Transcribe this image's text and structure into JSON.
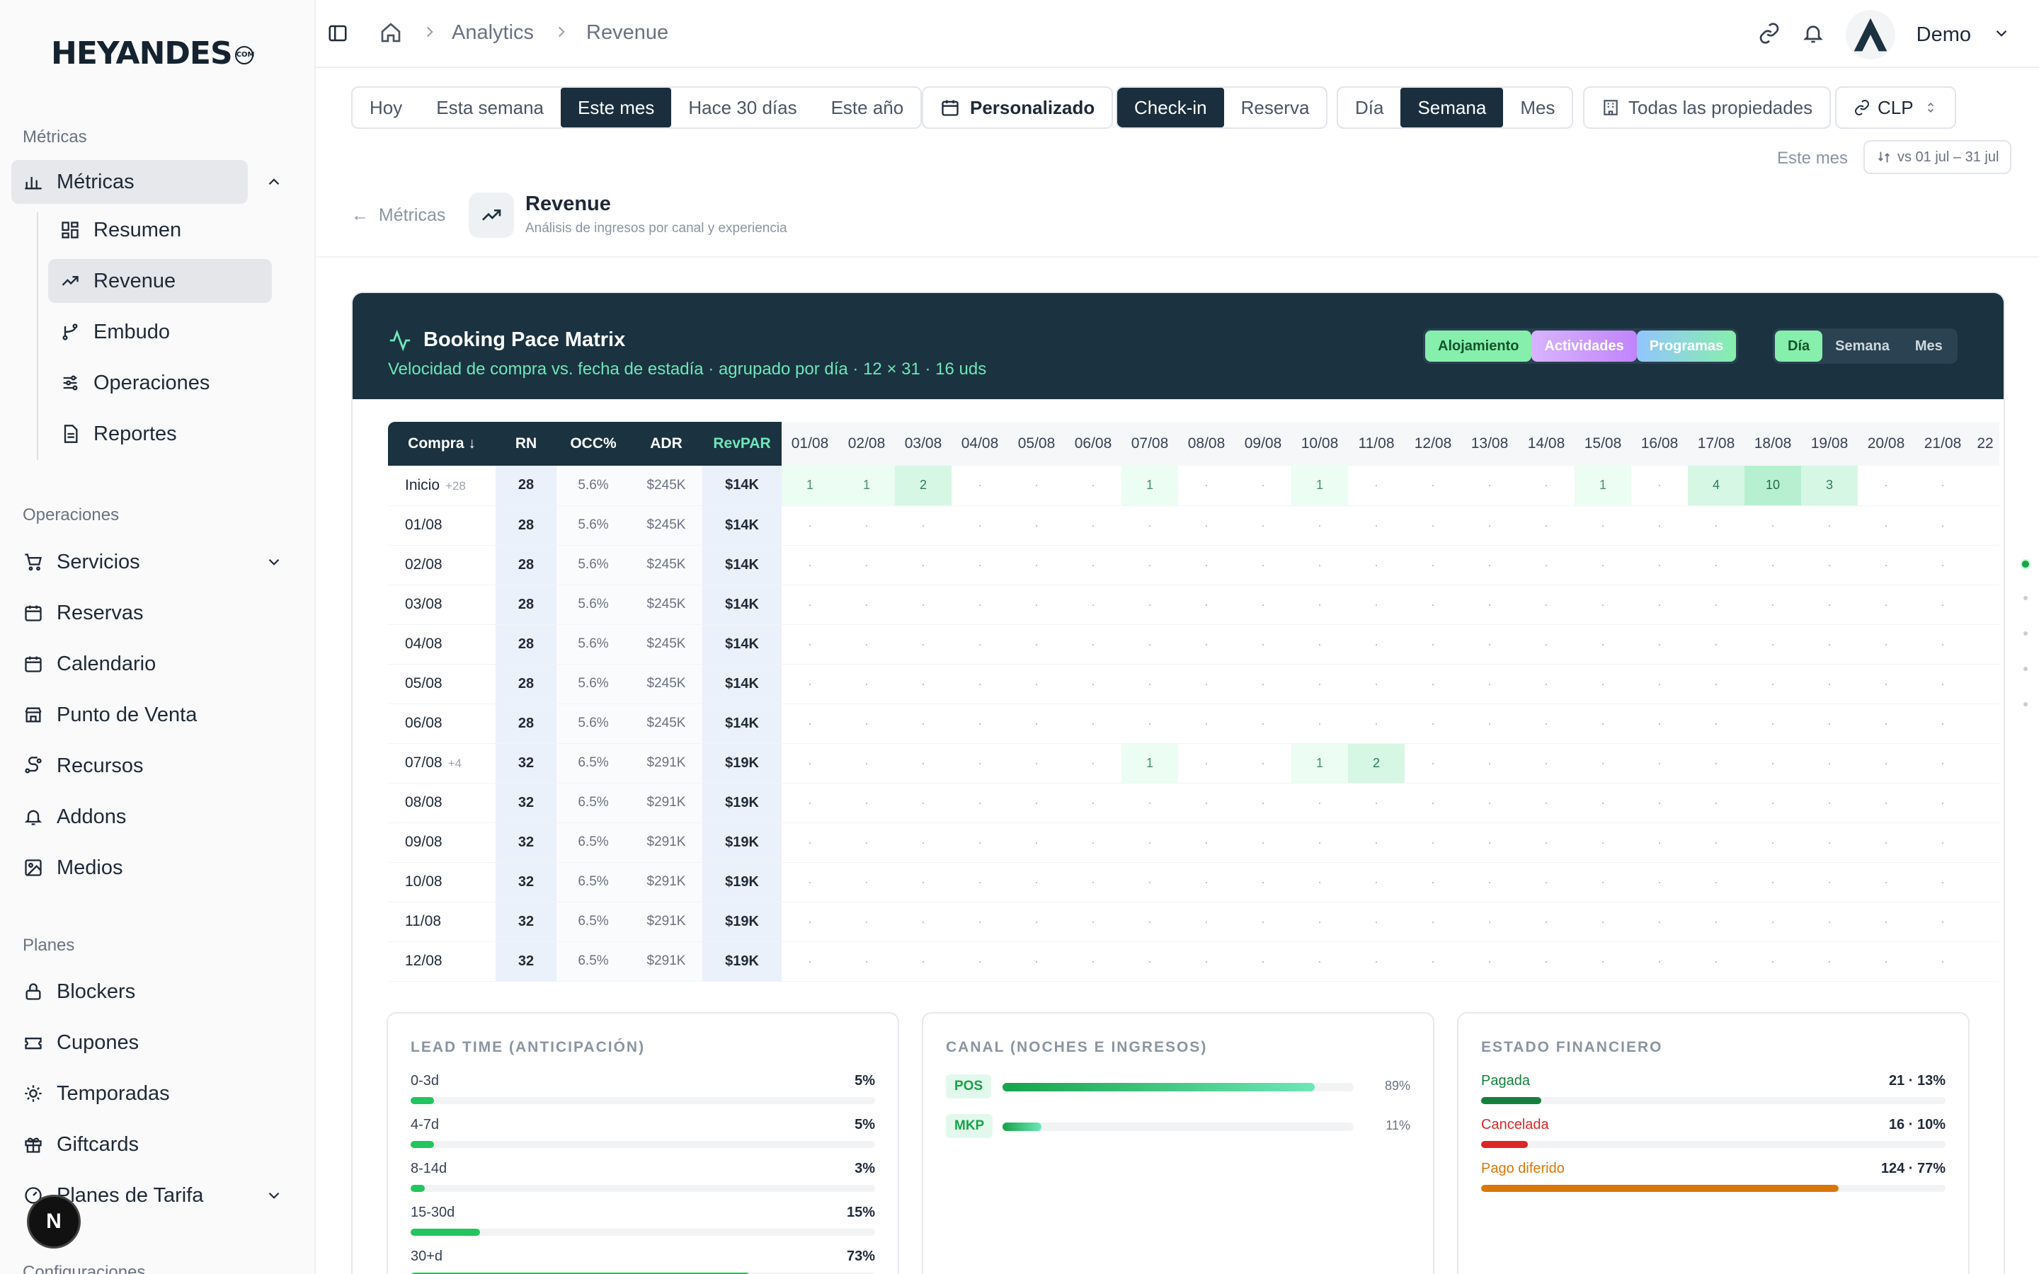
{
  "brand": {
    "name": "HEYANDES",
    "suffix": "COM"
  },
  "sidebar": {
    "sections": [
      {
        "label": "Métricas"
      },
      {
        "label": "Operaciones"
      },
      {
        "label": "Planes"
      },
      {
        "label": "Configuraciones"
      }
    ],
    "metricas": {
      "label": "Métricas",
      "sub": [
        "Resumen",
        "Revenue",
        "Embudo",
        "Operaciones",
        "Reportes"
      ]
    },
    "operaciones": [
      "Servicios",
      "Reservas",
      "Calendario",
      "Punto de Venta",
      "Recursos",
      "Addons",
      "Medios"
    ],
    "planes": [
      "Blockers",
      "Cupones",
      "Temporadas",
      "Giftcards",
      "Planes de Tarifa"
    ],
    "badge": "N"
  },
  "header": {
    "crumbs": [
      "Analytics",
      "Revenue"
    ],
    "user": "Demo"
  },
  "toolbar": {
    "periods": [
      "Hoy",
      "Esta semana",
      "Este mes",
      "Hace 30 días",
      "Este año"
    ],
    "active_period": "Este mes",
    "custom": "Personalizado",
    "date_modes": [
      "Check-in",
      "Reserva"
    ],
    "granularity": [
      "Día",
      "Semana",
      "Mes"
    ],
    "properties": "Todas las propiedades",
    "currency": "CLP",
    "compare_label": "Este mes",
    "compare_range": "vs 01 jul – 31 jul"
  },
  "page": {
    "back": "Métricas",
    "title": "Revenue",
    "subtitle": "Análisis de ingresos por canal y experiencia"
  },
  "matrix": {
    "title": "Booking Pace Matrix",
    "subtitle": "Velocidad de compra vs. fecha de estadía · agrupado por día · 12 × 31 · 16 uds",
    "filters": [
      "Alojamiento",
      "Actividades",
      "Programas"
    ],
    "groupings": [
      "Día",
      "Semana",
      "Mes"
    ],
    "head": [
      "Compra ↓",
      "RN",
      "OCC%",
      "ADR",
      "RevPAR"
    ],
    "dates": [
      "01/08",
      "02/08",
      "03/08",
      "04/08",
      "05/08",
      "06/08",
      "07/08",
      "08/08",
      "09/08",
      "10/08",
      "11/08",
      "12/08",
      "13/08",
      "14/08",
      "15/08",
      "16/08",
      "17/08",
      "18/08",
      "19/08",
      "20/08",
      "21/08",
      "22"
    ],
    "rows": [
      {
        "label": "Inicio",
        "plus": "+28",
        "rn": "28",
        "occ": "5.6%",
        "adr": "$245K",
        "rev": "$14K",
        "cells": [
          "1",
          "1",
          "2",
          "·",
          "·",
          "·",
          "1",
          "·",
          "·",
          "1",
          "·",
          "·",
          "·",
          "·",
          "1",
          "·",
          "4",
          "10",
          "3",
          "·",
          "·",
          ""
        ]
      },
      {
        "label": "01/08",
        "plus": "",
        "rn": "28",
        "occ": "5.6%",
        "adr": "$245K",
        "rev": "$14K",
        "cells": [
          "·",
          "·",
          "·",
          "·",
          "·",
          "·",
          "·",
          "·",
          "·",
          "·",
          "·",
          "·",
          "·",
          "·",
          "·",
          "·",
          "·",
          "·",
          "·",
          "·",
          "·",
          ""
        ]
      },
      {
        "label": "02/08",
        "plus": "",
        "rn": "28",
        "occ": "5.6%",
        "adr": "$245K",
        "rev": "$14K",
        "cells": [
          "·",
          "·",
          "·",
          "·",
          "·",
          "·",
          "·",
          "·",
          "·",
          "·",
          "·",
          "·",
          "·",
          "·",
          "·",
          "·",
          "·",
          "·",
          "·",
          "·",
          "·",
          ""
        ]
      },
      {
        "label": "03/08",
        "plus": "",
        "rn": "28",
        "occ": "5.6%",
        "adr": "$245K",
        "rev": "$14K",
        "cells": [
          "·",
          "·",
          "·",
          "·",
          "·",
          "·",
          "·",
          "·",
          "·",
          "·",
          "·",
          "·",
          "·",
          "·",
          "·",
          "·",
          "·",
          "·",
          "·",
          "·",
          "·",
          ""
        ]
      },
      {
        "label": "04/08",
        "plus": "",
        "rn": "28",
        "occ": "5.6%",
        "adr": "$245K",
        "rev": "$14K",
        "cells": [
          "·",
          "·",
          "·",
          "·",
          "·",
          "·",
          "·",
          "·",
          "·",
          "·",
          "·",
          "·",
          "·",
          "·",
          "·",
          "·",
          "·",
          "·",
          "·",
          "·",
          "·",
          ""
        ]
      },
      {
        "label": "05/08",
        "plus": "",
        "rn": "28",
        "occ": "5.6%",
        "adr": "$245K",
        "rev": "$14K",
        "cells": [
          "·",
          "·",
          "·",
          "·",
          "·",
          "·",
          "·",
          "·",
          "·",
          "·",
          "·",
          "·",
          "·",
          "·",
          "·",
          "·",
          "·",
          "·",
          "·",
          "·",
          "·",
          ""
        ]
      },
      {
        "label": "06/08",
        "plus": "",
        "rn": "28",
        "occ": "5.6%",
        "adr": "$245K",
        "rev": "$14K",
        "cells": [
          "·",
          "·",
          "·",
          "·",
          "·",
          "·",
          "·",
          "·",
          "·",
          "·",
          "·",
          "·",
          "·",
          "·",
          "·",
          "·",
          "·",
          "·",
          "·",
          "·",
          "·",
          ""
        ]
      },
      {
        "label": "07/08",
        "plus": "+4",
        "rn": "32",
        "occ": "6.5%",
        "adr": "$291K",
        "rev": "$19K",
        "cells": [
          "·",
          "·",
          "·",
          "·",
          "·",
          "·",
          "1",
          "·",
          "·",
          "1",
          "2",
          "·",
          "·",
          "·",
          "·",
          "·",
          "·",
          "·",
          "·",
          "·",
          "·",
          ""
        ]
      },
      {
        "label": "08/08",
        "plus": "",
        "rn": "32",
        "occ": "6.5%",
        "adr": "$291K",
        "rev": "$19K",
        "cells": [
          "·",
          "·",
          "·",
          "·",
          "·",
          "·",
          "·",
          "·",
          "·",
          "·",
          "·",
          "·",
          "·",
          "·",
          "·",
          "·",
          "·",
          "·",
          "·",
          "·",
          "·",
          ""
        ]
      },
      {
        "label": "09/08",
        "plus": "",
        "rn": "32",
        "occ": "6.5%",
        "adr": "$291K",
        "rev": "$19K",
        "cells": [
          "·",
          "·",
          "·",
          "·",
          "·",
          "·",
          "·",
          "·",
          "·",
          "·",
          "·",
          "·",
          "·",
          "·",
          "·",
          "·",
          "·",
          "·",
          "·",
          "·",
          "·",
          ""
        ]
      },
      {
        "label": "10/08",
        "plus": "",
        "rn": "32",
        "occ": "6.5%",
        "adr": "$291K",
        "rev": "$19K",
        "cells": [
          "·",
          "·",
          "·",
          "·",
          "·",
          "·",
          "·",
          "·",
          "·",
          "·",
          "·",
          "·",
          "·",
          "·",
          "·",
          "·",
          "·",
          "·",
          "·",
          "·",
          "·",
          ""
        ]
      },
      {
        "label": "11/08",
        "plus": "",
        "rn": "32",
        "occ": "6.5%",
        "adr": "$291K",
        "rev": "$19K",
        "cells": [
          "·",
          "·",
          "·",
          "·",
          "·",
          "·",
          "·",
          "·",
          "·",
          "·",
          "·",
          "·",
          "·",
          "·",
          "·",
          "·",
          "·",
          "·",
          "·",
          "·",
          "·",
          ""
        ]
      },
      {
        "label": "12/08",
        "plus": "",
        "rn": "32",
        "occ": "6.5%",
        "adr": "$291K",
        "rev": "$19K",
        "cells": [
          "·",
          "·",
          "·",
          "·",
          "·",
          "·",
          "·",
          "·",
          "·",
          "·",
          "·",
          "·",
          "·",
          "·",
          "·",
          "·",
          "·",
          "·",
          "·",
          "·",
          "·",
          ""
        ]
      }
    ]
  },
  "lead_time": {
    "title": "LEAD TIME (ANTICIPACIÓN)",
    "items": [
      {
        "label": "0-3d",
        "value": "5%",
        "pct": 5
      },
      {
        "label": "4-7d",
        "value": "5%",
        "pct": 5
      },
      {
        "label": "8-14d",
        "value": "3%",
        "pct": 3
      },
      {
        "label": "15-30d",
        "value": "15%",
        "pct": 15
      },
      {
        "label": "30+d",
        "value": "73%",
        "pct": 73
      }
    ]
  },
  "canal": {
    "title": "CANAL (NOCHES E INGRESOS)",
    "items": [
      {
        "label": "POS",
        "value": "89%",
        "pct": 89
      },
      {
        "label": "MKP",
        "value": "11%",
        "pct": 11
      }
    ]
  },
  "financiero": {
    "title": "ESTADO FINANCIERO",
    "items": [
      {
        "label": "Pagada",
        "value": "21 · 13%",
        "pct": 13,
        "color": "#15803d"
      },
      {
        "label": "Cancelada",
        "value": "16 · 10%",
        "pct": 10,
        "color": "#dc2626"
      },
      {
        "label": "Pago diferido",
        "value": "124 · 77%",
        "pct": 77,
        "color": "#d97706"
      }
    ]
  }
}
